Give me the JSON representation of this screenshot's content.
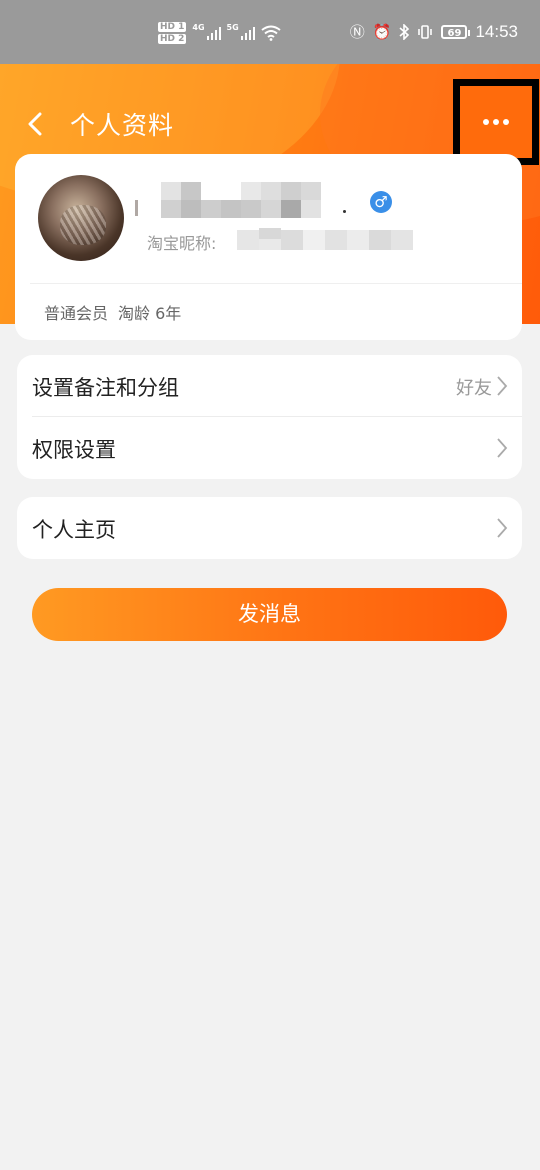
{
  "status_bar": {
    "hd1": "HD 1",
    "hd2": "HD 2",
    "net1": "4G",
    "net2": "5G",
    "battery": "69",
    "time": "14:53"
  },
  "header": {
    "title": "个人资料"
  },
  "profile": {
    "nickname_label": "淘宝昵称:",
    "nickname_first_char": "ì",
    "gender_symbol": "♂",
    "member_level": "普通会员",
    "taobao_age": "淘龄 6年"
  },
  "menu_group1": {
    "items": [
      {
        "label": "设置备注和分组",
        "value": "好友"
      },
      {
        "label": "权限设置",
        "value": ""
      }
    ]
  },
  "menu_group2": {
    "items": [
      {
        "label": "个人主页"
      }
    ]
  },
  "send_button": {
    "label": "发消息"
  },
  "colors": {
    "accent": "#ff7314",
    "gradient_start": "#ff9a22",
    "gradient_end": "#ff5a0a",
    "gender_blue": "#3a8fe8"
  }
}
